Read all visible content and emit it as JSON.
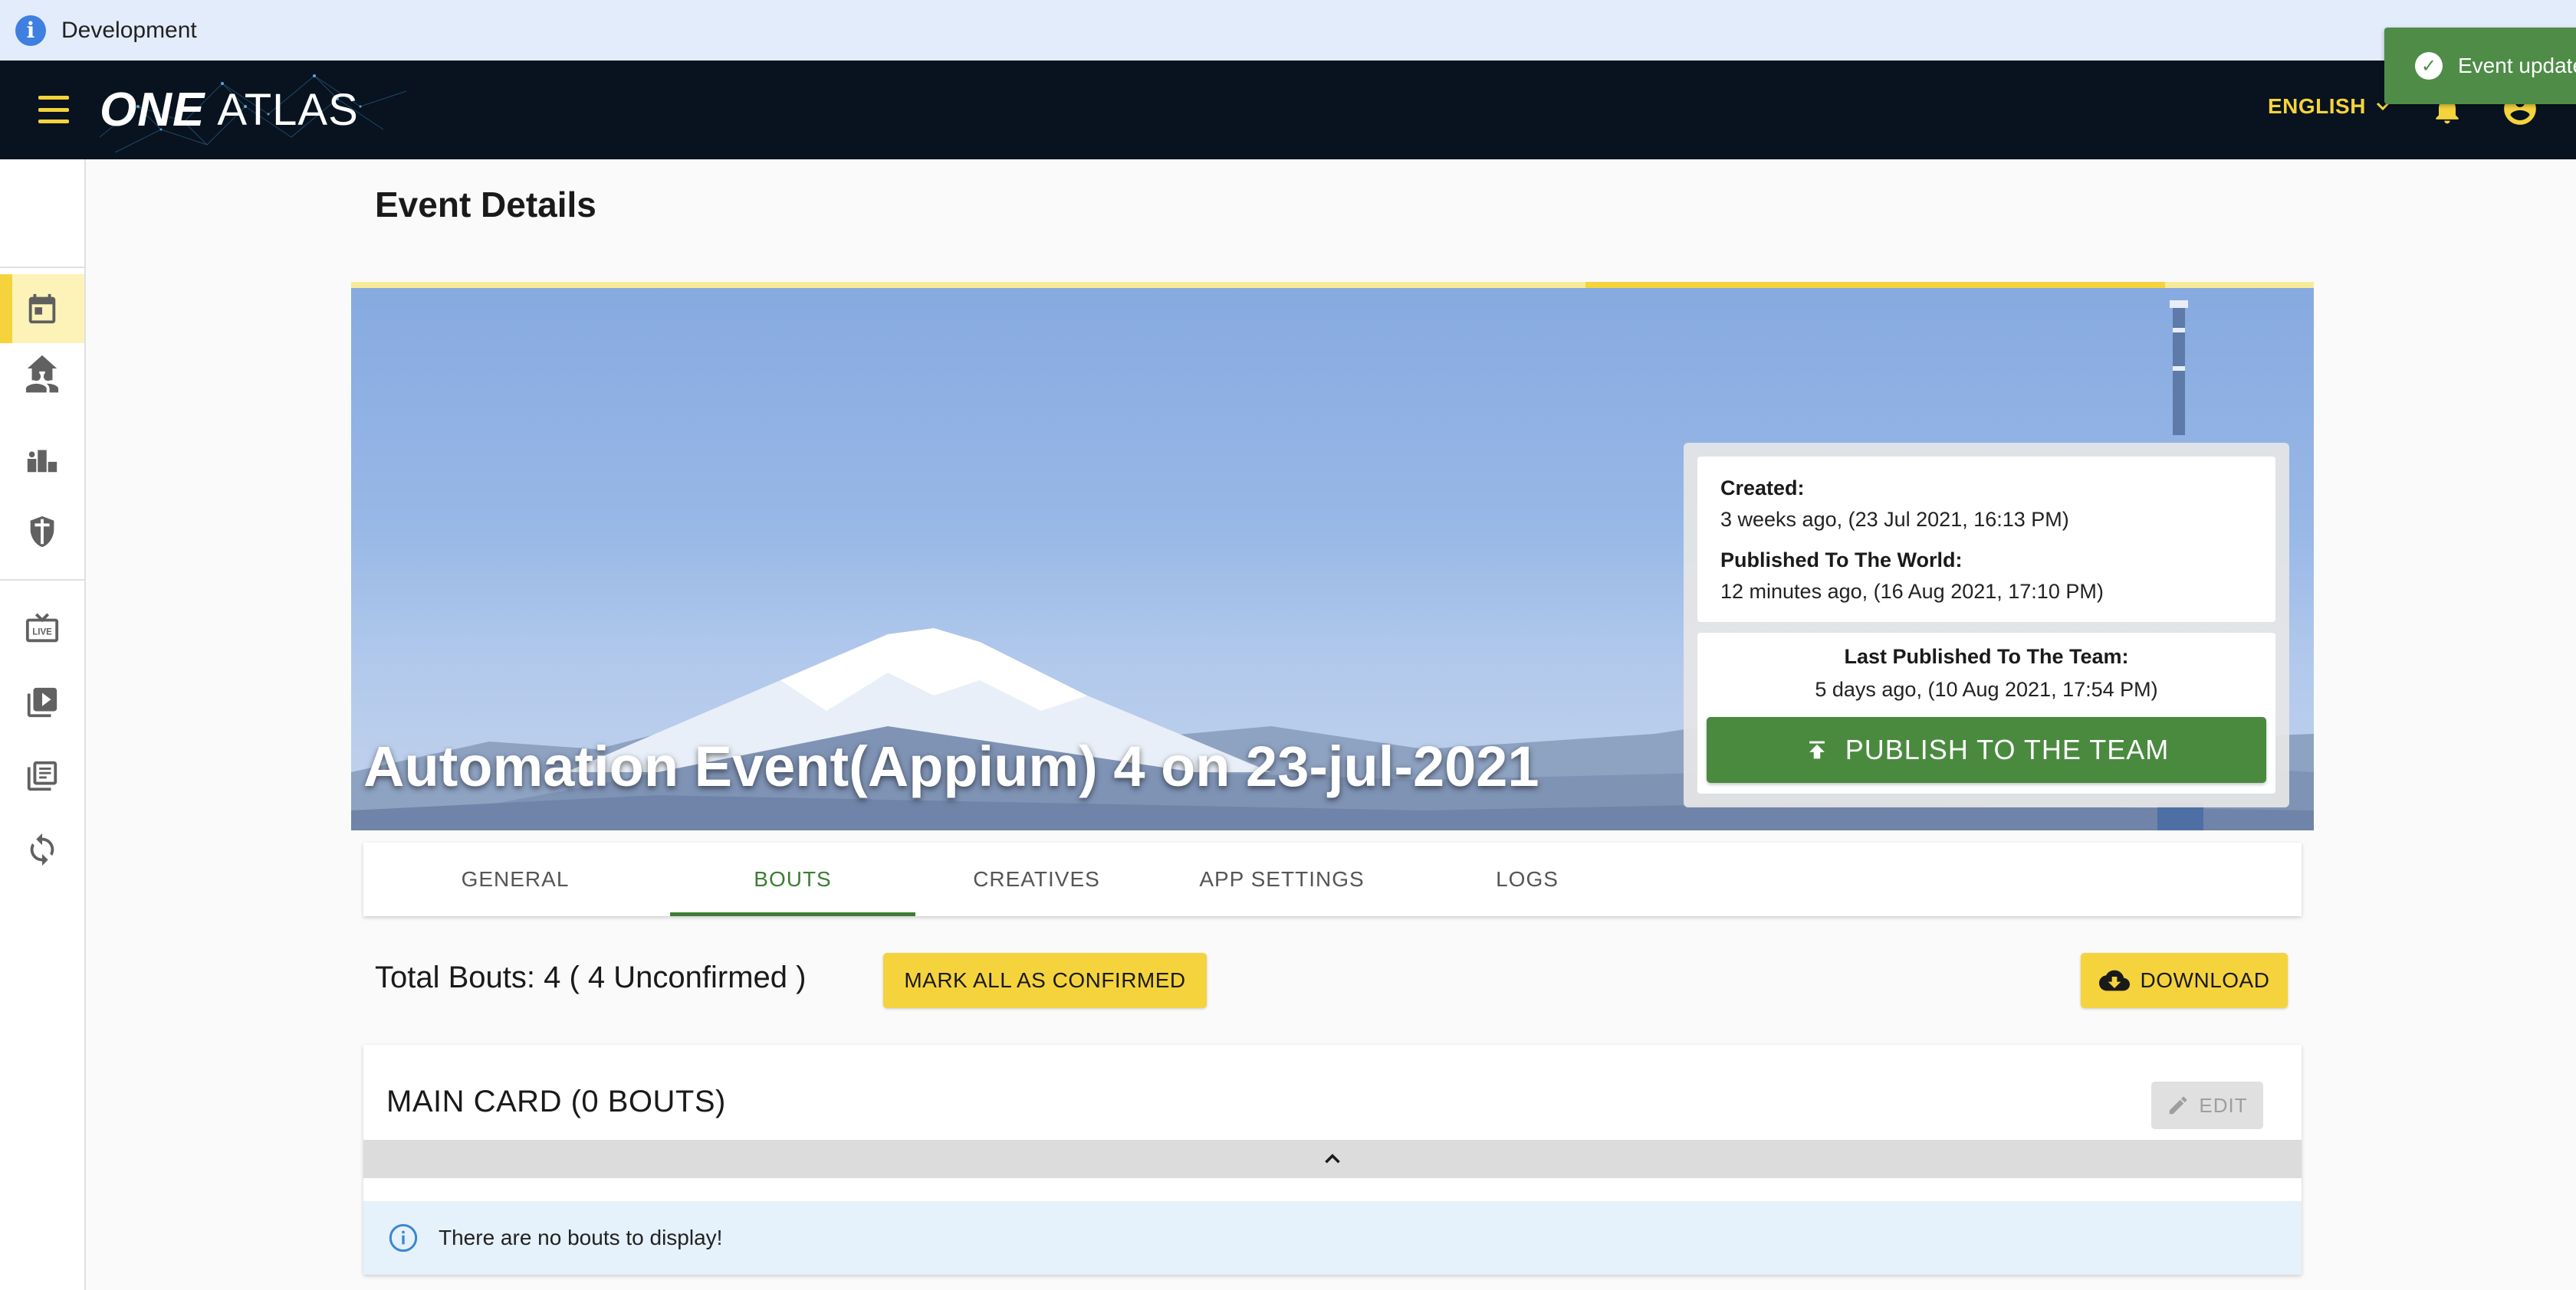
{
  "banner": {
    "label": "Development"
  },
  "appbar": {
    "logo_one": "ONE",
    "logo_atlas": "ATLAS",
    "language": "ENGLISH",
    "accent_color": "#f5d33c"
  },
  "toast": {
    "text": "Event updated"
  },
  "sidebar": {
    "items": [
      {
        "icon": "home-icon"
      },
      {
        "icon": "calendar-icon",
        "active": true
      },
      {
        "icon": "people-icon"
      },
      {
        "icon": "podium-icon"
      },
      {
        "icon": "shield-icon"
      },
      {
        "icon": "live-tv-icon"
      },
      {
        "icon": "video-library-icon"
      },
      {
        "icon": "collections-icon"
      },
      {
        "icon": "sync-icon"
      }
    ]
  },
  "page": {
    "title": "Event Details"
  },
  "hero": {
    "event_title": "Automation Event(Appium) 4 on 23-jul-2021"
  },
  "publish_panel": {
    "created_label": "Created:",
    "created_value": "3 weeks ago, (23 Jul 2021, 16:13 PM)",
    "world_label": "Published To The World:",
    "world_value": "12 minutes ago, (16 Aug 2021, 17:10 PM)",
    "team_label": "Last Published To The Team:",
    "team_value": "5 days ago, (10 Aug 2021, 17:54 PM)",
    "publish_button": "PUBLISH TO THE TEAM"
  },
  "tabs": [
    {
      "label": "GENERAL"
    },
    {
      "label": "BOUTS",
      "active": true
    },
    {
      "label": "CREATIVES"
    },
    {
      "label": "APP SETTINGS"
    },
    {
      "label": "LOGS"
    }
  ],
  "bouts": {
    "total_text": "Total Bouts: 4 ( 4 Unconfirmed )",
    "mark_all_button": "MARK ALL AS CONFIRMED",
    "download_button": "DOWNLOAD"
  },
  "main_card": {
    "title": "MAIN CARD (0 BOUTS)",
    "edit_button": "EDIT",
    "empty_message": "There are no bouts to display!"
  }
}
